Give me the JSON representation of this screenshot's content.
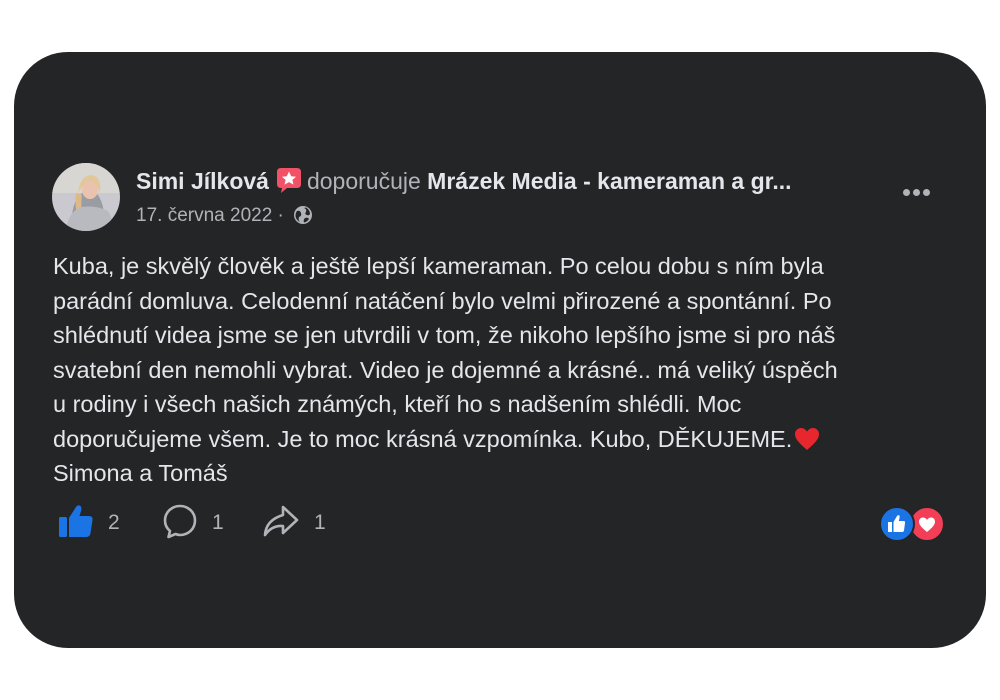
{
  "post": {
    "author": "Simi Jílková",
    "action": "doporučuje",
    "page_name": "Mrázek Media - kameraman a gr...",
    "date": "17. června 2022",
    "separator": "·",
    "body_lines": [
      "Kuba, je skvělý člověk a ještě lepší kameraman. Po celou dobu s ním byla",
      "parádní domluva. Celodenní natáčení bylo velmi přirozené a spontánní. Po",
      "shlédnutí videa jsme se jen utvrdili v tom, že nikoho lepšího jsme si pro náš",
      "svatební den nemohli vybrat. Video je dojemné a krásné.. má veliký úspěch",
      "u rodiny i všech našich známých, kteří ho s nadšením shlédli. Moc",
      "doporučujeme všem. Je to moc krásná vzpomínka. Kubo, DĚKUJEME.",
      "Simona a Tomáš"
    ]
  },
  "actions": {
    "likes": "2",
    "comments": "1",
    "shares": "1"
  },
  "colors": {
    "card": "#242526",
    "text": "#e4e6eb",
    "secondary": "#b0b3b8",
    "like_blue": "#1b74e4",
    "love_red": "#f33e58",
    "badge_pink": "#f25268"
  },
  "icons": [
    "avatar",
    "star-badge-icon",
    "globe-icon",
    "more-icon",
    "red-heart-icon",
    "like-icon",
    "comment-icon",
    "share-icon",
    "like-reaction-icon",
    "love-reaction-icon"
  ]
}
